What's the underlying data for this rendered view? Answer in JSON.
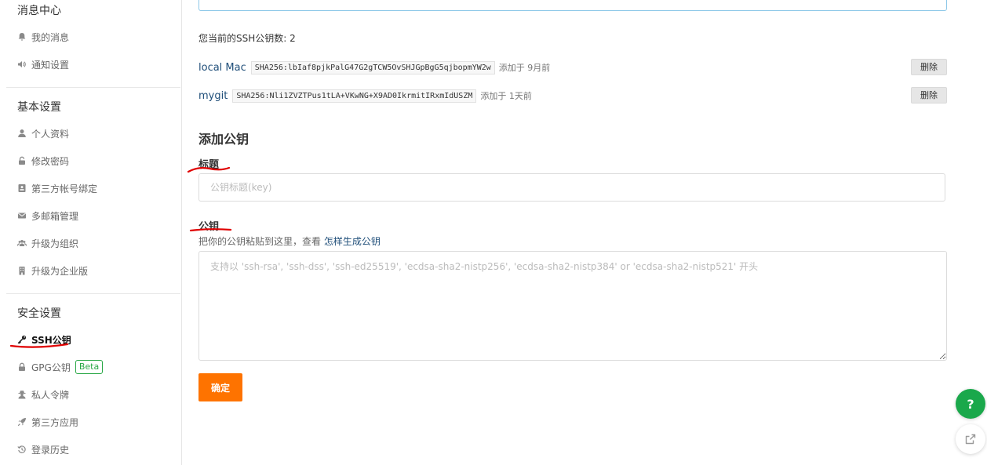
{
  "sidebar": {
    "messages": {
      "title": "消息中心",
      "items": [
        {
          "label": "我的消息",
          "icon": "bell-icon"
        },
        {
          "label": "通知设置",
          "icon": "volume-icon"
        }
      ]
    },
    "basic": {
      "title": "基本设置",
      "items": [
        {
          "label": "个人资料",
          "icon": "user-icon"
        },
        {
          "label": "修改密码",
          "icon": "unlock-icon"
        },
        {
          "label": "第三方帐号绑定",
          "icon": "id-card-icon"
        },
        {
          "label": "多邮箱管理",
          "icon": "envelope-icon"
        },
        {
          "label": "升级为组织",
          "icon": "users-icon"
        },
        {
          "label": "升级为企业版",
          "icon": "building-icon"
        }
      ]
    },
    "security": {
      "title": "安全设置",
      "items": [
        {
          "label": "SSH公钥",
          "icon": "key-icon",
          "active": true
        },
        {
          "label": "GPG公钥",
          "icon": "lock-icon",
          "badge": "Beta"
        },
        {
          "label": "私人令牌",
          "icon": "user-secret-icon"
        },
        {
          "label": "第三方应用",
          "icon": "rocket-icon"
        },
        {
          "label": "登录历史",
          "icon": "history-icon"
        }
      ]
    }
  },
  "main": {
    "key_count_text": "您当前的SSH公钥数: 2",
    "keys": [
      {
        "title": "local Mac",
        "fingerprint": "SHA256:lbIaf8pjkPalG47G2gTCW5OvSHJGpBgG5qjbopmYW2w",
        "added": "添加于 9月前",
        "delete_label": "删除"
      },
      {
        "title": "mygit",
        "fingerprint": "SHA256:Nli1ZVZTPus1tLA+VKwNG+X9AD0IkrmitIRxmIdUSZM",
        "added": "添加于 1天前",
        "delete_label": "删除"
      }
    ],
    "add_heading": "添加公钥",
    "title_label": "标题",
    "title_placeholder": "公钥标题(key)",
    "pubkey_label": "公钥",
    "hint_text": "把你的公钥粘贴到这里，查看 ",
    "hint_link": "怎样生成公钥",
    "pubkey_placeholder": "支持以 'ssh-rsa', 'ssh-dss', 'ssh-ed25519', 'ecdsa-sha2-nistp256', 'ecdsa-sha2-nistp384' or 'ecdsa-sha2-nistp521' 开头",
    "confirm_label": "确定"
  },
  "floating": {
    "help_label": "?",
    "help_icon": "question-icon",
    "feedback_icon": "external-link-icon"
  },
  "colors": {
    "accent_orange": "#fe7300",
    "help_green": "#1aa84b",
    "annotation_red": "#e00000",
    "link_blue": "#1f4e79"
  }
}
